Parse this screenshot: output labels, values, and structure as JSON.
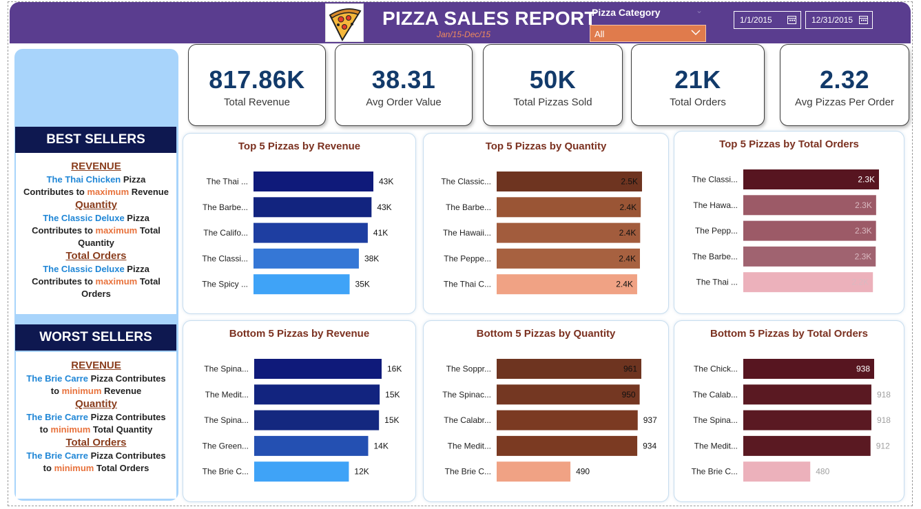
{
  "header": {
    "title": "PIZZA SALES REPORT",
    "subtitle": "Jan/15-Dec/15",
    "category_label": "Pizza Category",
    "category_value": "All",
    "date_start": "1/1/2015",
    "date_end": "12/31/2015"
  },
  "kpis": [
    {
      "value": "817.86K",
      "label": "Total Revenue"
    },
    {
      "value": "38.31",
      "label": "Avg Order Value"
    },
    {
      "value": "50K",
      "label": "Total Pizzas Sold"
    },
    {
      "value": "21K",
      "label": "Total Orders"
    },
    {
      "value": "2.32",
      "label": "Avg Pizzas Per Order"
    }
  ],
  "best": {
    "title": "BEST SELLERS",
    "revenue_title": "REVENUE",
    "revenue_name": "The Thai Chicken",
    "revenue_pre": " Pizza Contributes to ",
    "revenue_kw": "maximum",
    "revenue_post": " Revenue",
    "quantity_title": "Quantity",
    "quantity_name": "The Classic Deluxe",
    "quantity_pre": " Pizza Contributes to ",
    "quantity_kw": "maximum",
    "quantity_post": " Total Quantity",
    "orders_title": "Total Orders",
    "orders_name": "The Classic Deluxe",
    "orders_pre": " Pizza Contributes to ",
    "orders_kw": "maximum",
    "orders_post": " Total Orders"
  },
  "worst": {
    "title": "WORST SELLERS",
    "revenue_title": "REVENUE",
    "revenue_name": "The Brie Carre",
    "revenue_pre": " Pizza Contributes to ",
    "revenue_kw": "minimum",
    "revenue_post": " Revenue",
    "quantity_title": "Quantity",
    "quantity_name": "The Brie Carre",
    "quantity_pre": " Pizza Contributes to ",
    "quantity_kw": "minimum",
    "quantity_post": " Total Quantity",
    "orders_title": "Total Orders",
    "orders_name": "The Brie Carre",
    "orders_pre": " Pizza Contributes to ",
    "orders_kw": "minimum",
    "orders_post": " Total Orders"
  },
  "chart_data": [
    {
      "type": "bar",
      "title": "Top 5 Pizzas by Revenue",
      "categories": [
        "The Thai ...",
        "The Barbe...",
        "The Califo...",
        "The Classi...",
        "The Spicy ..."
      ],
      "values": [
        43434,
        42768,
        41410,
        38180,
        34831
      ],
      "labels": [
        "43K",
        "43K",
        "41K",
        "38K",
        "35K"
      ],
      "colors": [
        "#0f1a7a",
        "#12247f",
        "#1e3ea1",
        "#3577d6",
        "#3fa3f7"
      ],
      "label_pos": "outside"
    },
    {
      "type": "bar",
      "title": "Top 5 Pizzas by Quantity",
      "categories": [
        "The Classic...",
        "The Barbe...",
        "The Hawaii...",
        "The Peppe...",
        "The Thai C..."
      ],
      "values": [
        2453,
        2432,
        2422,
        2418,
        2371
      ],
      "labels": [
        "2.5K",
        "2.4K",
        "2.4K",
        "2.4K",
        "2.4K"
      ],
      "colors": [
        "#6e3420",
        "#9a5535",
        "#a25c3d",
        "#a76140",
        "#f0a284"
      ],
      "label_pos": "inside"
    },
    {
      "type": "bar",
      "title": "Top 5 Pizzas by Total Orders",
      "categories": [
        "The Classi...",
        "The Hawa...",
        "The Pepp...",
        "The Barbe...",
        "The Thai ..."
      ],
      "values": [
        2329,
        2280,
        2278,
        2273,
        2225
      ],
      "labels": [
        "2.3K",
        "2.3K",
        "2.3K",
        "2.3K",
        "2.2K"
      ],
      "colors": [
        "#571520",
        "#9c5a67",
        "#9c5a67",
        "#a06370",
        "#ecb1bb"
      ],
      "label_pos": "inside"
    },
    {
      "type": "bar",
      "title": "Bottom 5 Pizzas by Revenue",
      "categories": [
        "The Spina...",
        "The Medit...",
        "The Spina...",
        "The Green...",
        "The Brie C..."
      ],
      "values": [
        15600,
        15360,
        15278,
        13956,
        11588
      ],
      "labels": [
        "16K",
        "15K",
        "15K",
        "14K",
        "12K"
      ],
      "colors": [
        "#0f1a7a",
        "#12247f",
        "#14287f",
        "#2450b2",
        "#3fa3f7"
      ],
      "label_pos": "outside"
    },
    {
      "type": "bar",
      "title": "Bottom 5 Pizzas by Quantity",
      "categories": [
        "The Soppr...",
        "The Spinac...",
        "The Calabr...",
        "The Medit...",
        "The Brie C..."
      ],
      "values": [
        961,
        950,
        937,
        934,
        490
      ],
      "labels": [
        "961",
        "950",
        "937",
        "934",
        "490"
      ],
      "colors": [
        "#6e3420",
        "#743722",
        "#7b3a22",
        "#7b3a22",
        "#f0a284"
      ],
      "label_pos": "mixed"
    },
    {
      "type": "bar",
      "title": "Bottom 5 Pizzas by Total Orders",
      "categories": [
        "The Chick...",
        "The Calab...",
        "The Spina...",
        "The Medit...",
        "The Brie C..."
      ],
      "values": [
        938,
        918,
        918,
        912,
        480
      ],
      "labels": [
        "938",
        "918",
        "918",
        "912",
        "480"
      ],
      "colors": [
        "#571520",
        "#5a1922",
        "#5a1922",
        "#5a1922",
        "#ecb1bb"
      ],
      "label_pos": "mixed"
    }
  ]
}
